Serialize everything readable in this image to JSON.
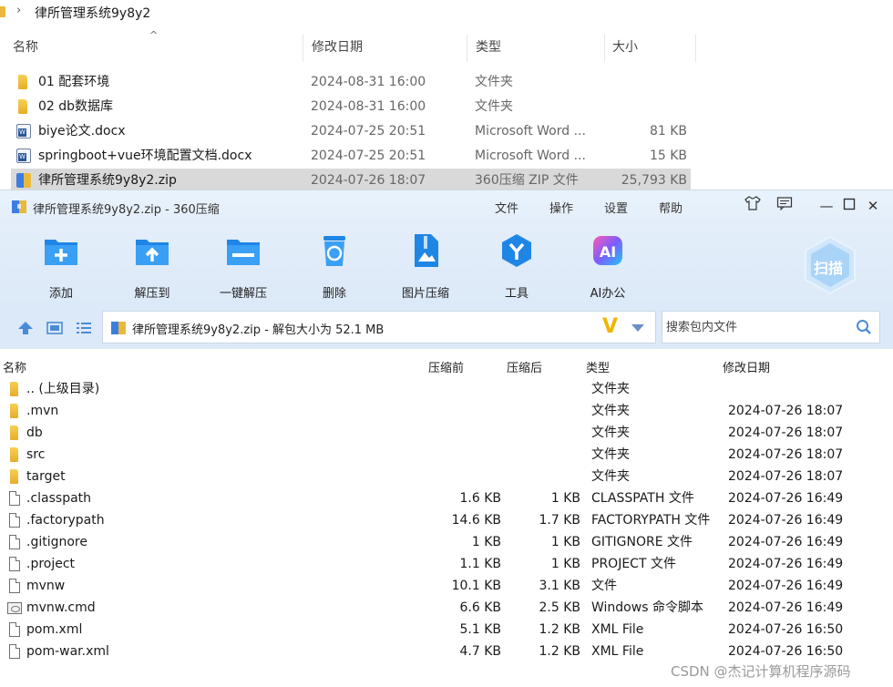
{
  "explorer": {
    "breadcrumb": "律所管理系统9y8y2",
    "columns": {
      "name": "名称",
      "modified": "修改日期",
      "type": "类型",
      "size": "大小"
    },
    "rows": [
      {
        "name": "01 配套环境",
        "modified": "2024-08-31 16:00",
        "type": "文件夹",
        "size": "",
        "icon": "folder-icon"
      },
      {
        "name": "02 db数据库",
        "modified": "2024-08-31 16:00",
        "type": "文件夹",
        "size": "",
        "icon": "folder-icon"
      },
      {
        "name": "biye论文.docx",
        "modified": "2024-07-25 20:51",
        "type": "Microsoft Word ...",
        "size": "81 KB",
        "icon": "word-doc-icon"
      },
      {
        "name": "springboot+vue环境配置文档.docx",
        "modified": "2024-07-25 20:51",
        "type": "Microsoft Word ...",
        "size": "15 KB",
        "icon": "word-doc-icon"
      },
      {
        "name": "律所管理系统9y8y2.zip",
        "modified": "2024-07-26 18:07",
        "type": "360压缩 ZIP 文件",
        "size": "25,793 KB",
        "icon": "zip-archive-icon",
        "selected": true
      }
    ]
  },
  "zipwin": {
    "title": "律所管理系统9y8y2.zip - 360压缩",
    "menu": [
      "文件",
      "操作",
      "设置",
      "帮助"
    ],
    "toolbar": [
      {
        "label": "添加",
        "icon": "add-icon"
      },
      {
        "label": "解压到",
        "icon": "extract-to-icon"
      },
      {
        "label": "一键解压",
        "icon": "one-click-extract-icon"
      },
      {
        "label": "删除",
        "icon": "delete-icon"
      },
      {
        "label": "图片压缩",
        "icon": "image-compress-icon"
      },
      {
        "label": "工具",
        "icon": "tools-icon"
      },
      {
        "label": "AI办公",
        "icon": "ai-office-icon"
      }
    ],
    "scan_label": "扫描",
    "address": "律所管理系统9y8y2.zip - 解包大小为 52.1 MB",
    "search_placeholder": "搜索包内文件",
    "columns": {
      "name": "名称",
      "before": "压缩前",
      "after": "压缩后",
      "type": "类型",
      "modified": "修改日期"
    },
    "rows": [
      {
        "name": ".. (上级目录)",
        "before": "",
        "after": "",
        "type": "文件夹",
        "modified": "",
        "icon": "folder"
      },
      {
        "name": ".mvn",
        "before": "",
        "after": "",
        "type": "文件夹",
        "modified": "2024-07-26 18:07",
        "icon": "folder"
      },
      {
        "name": "db",
        "before": "",
        "after": "",
        "type": "文件夹",
        "modified": "2024-07-26 18:07",
        "icon": "folder"
      },
      {
        "name": "src",
        "before": "",
        "after": "",
        "type": "文件夹",
        "modified": "2024-07-26 18:07",
        "icon": "folder"
      },
      {
        "name": "target",
        "before": "",
        "after": "",
        "type": "文件夹",
        "modified": "2024-07-26 18:07",
        "icon": "folder"
      },
      {
        "name": ".classpath",
        "before": "1.6 KB",
        "after": "1 KB",
        "type": "CLASSPATH 文件",
        "modified": "2024-07-26 16:49",
        "icon": "file"
      },
      {
        "name": ".factorypath",
        "before": "14.6 KB",
        "after": "1.7 KB",
        "type": "FACTORYPATH 文件",
        "modified": "2024-07-26 16:49",
        "icon": "file"
      },
      {
        "name": ".gitignore",
        "before": "1 KB",
        "after": "1 KB",
        "type": "GITIGNORE 文件",
        "modified": "2024-07-26 16:49",
        "icon": "file"
      },
      {
        "name": ".project",
        "before": "1.1 KB",
        "after": "1 KB",
        "type": "PROJECT 文件",
        "modified": "2024-07-26 16:49",
        "icon": "file"
      },
      {
        "name": "mvnw",
        "before": "10.1 KB",
        "after": "3.1 KB",
        "type": "文件",
        "modified": "2024-07-26 16:49",
        "icon": "file"
      },
      {
        "name": "mvnw.cmd",
        "before": "6.6 KB",
        "after": "2.5 KB",
        "type": "Windows 命令脚本",
        "modified": "2024-07-26 16:49",
        "icon": "cmd"
      },
      {
        "name": "pom.xml",
        "before": "5.1 KB",
        "after": "1.2 KB",
        "type": "XML File",
        "modified": "2024-07-26 16:50",
        "icon": "file"
      },
      {
        "name": "pom-war.xml",
        "before": "4.7 KB",
        "after": "1.2 KB",
        "type": "XML File",
        "modified": "2024-07-26 16:50",
        "icon": "file"
      }
    ]
  },
  "watermark": "CSDN @杰记计算机程序源码",
  "colors": {
    "toolbar_bg": "#dce9f8",
    "icon_blue": "#1f86e6",
    "selected_row": "#d9d9d9",
    "v_logo": "#f0b400"
  }
}
